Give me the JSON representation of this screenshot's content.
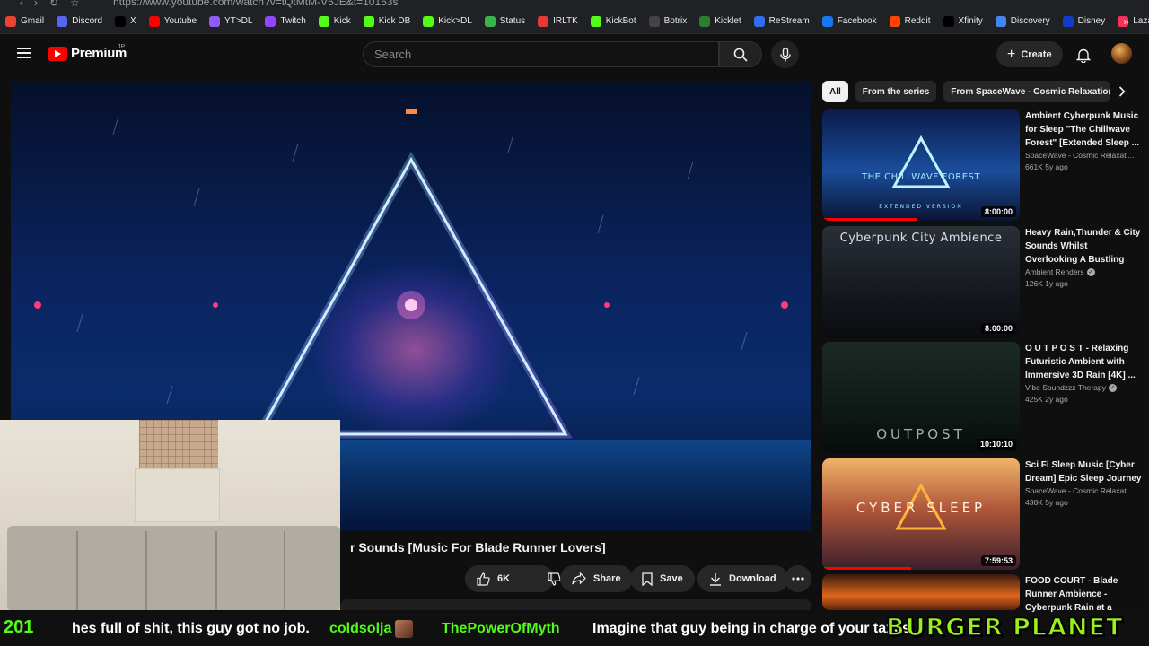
{
  "browser": {
    "url": "https://www.youtube.com/watch?v=tQtMtM-V5JE&t=10153s",
    "bookmarks": [
      {
        "label": "Gmail",
        "icon": "gmail-icon",
        "color": "#ea4335"
      },
      {
        "label": "Discord",
        "icon": "discord-icon",
        "color": "#5865f2"
      },
      {
        "label": "X",
        "icon": "x-icon",
        "color": "#000000"
      },
      {
        "label": "Youtube",
        "icon": "youtube-icon",
        "color": "#ff0000"
      },
      {
        "label": "YT>DL",
        "icon": "ytdl-icon",
        "color": "#8e5cf6"
      },
      {
        "label": "Twitch",
        "icon": "twitch-icon",
        "color": "#9146ff"
      },
      {
        "label": "Kick",
        "icon": "kick-icon",
        "color": "#53fc18"
      },
      {
        "label": "Kick DB",
        "icon": "kick-icon",
        "color": "#53fc18"
      },
      {
        "label": "Kick>DL",
        "icon": "kick-icon",
        "color": "#53fc18"
      },
      {
        "label": "Status",
        "icon": "status-icon",
        "color": "#3bb54a"
      },
      {
        "label": "IRLTK",
        "icon": "irltk-icon",
        "color": "#e53935"
      },
      {
        "label": "KickBot",
        "icon": "kickbot-icon",
        "color": "#53fc18"
      },
      {
        "label": "Botrix",
        "icon": "botrix-icon",
        "color": "#444444"
      },
      {
        "label": "Kicklet",
        "icon": "kicklet-icon",
        "color": "#2e7d32"
      },
      {
        "label": "ReStream",
        "icon": "restream-icon",
        "color": "#2f6fed"
      },
      {
        "label": "Facebook",
        "icon": "facebook-icon",
        "color": "#1877f2"
      },
      {
        "label": "Reddit",
        "icon": "reddit-icon",
        "color": "#ff4500"
      },
      {
        "label": "Xfinity",
        "icon": "xfinity-icon",
        "color": "#000000"
      },
      {
        "label": "Discovery",
        "icon": "discovery-icon",
        "color": "#4285f4"
      },
      {
        "label": "Disney",
        "icon": "disney-icon",
        "color": "#113ccf"
      },
      {
        "label": "Lazada",
        "icon": "lazada-icon",
        "color": "#f5315a"
      }
    ],
    "more_label": "»"
  },
  "header": {
    "brand": "Premium",
    "country": "JP",
    "search_placeholder": "Search",
    "create_label": "Create"
  },
  "video": {
    "title": "r Sounds [Music For Blade Runner Lovers]",
    "like_count": "6K",
    "share_label": "Share",
    "save_label": "Save",
    "download_label": "Download"
  },
  "sidebar": {
    "chips": [
      "All",
      "From the series",
      "From SpaceWave - Cosmic Relaxation"
    ],
    "recommendations": [
      {
        "title": "Ambient Cyberpunk Music for Sleep \"The Chillwave Forest\" [Extended Sleep ...",
        "channel": "SpaceWave - Cosmic Relaxati...",
        "stats": "661K  5y ago",
        "duration": "8:00:00",
        "thumb_text": "THE CHILLWAVE FOREST",
        "thumb_sub": "EXTENDED VERSION",
        "verified": false,
        "watched": 0.48
      },
      {
        "title": "Heavy Rain,Thunder & City Sounds Whilst Overlooking A Bustling NightTime ...",
        "channel": "Ambient Renders",
        "stats": "126K  1y ago",
        "duration": "8:00:00",
        "thumb_text": "Cyberpunk City Ambience",
        "thumb_sub": "",
        "verified": true,
        "watched": 0
      },
      {
        "title": "O U T P O S T  - Relaxing Futuristic Ambient with Immersive 3D Rain [4K] ...",
        "channel": "Vibe Soundzzz Therapy",
        "stats": "425K  2y ago",
        "duration": "10:10:10",
        "thumb_text": "OUTPOST",
        "thumb_sub": "",
        "verified": true,
        "watched": 0
      },
      {
        "title": "Sci Fi Sleep Music [Cyber Dream] Epic Sleep Journey",
        "channel": "SpaceWave - Cosmic Relaxati...",
        "stats": "438K  5y ago",
        "duration": "7:59:53",
        "thumb_text": "CYBER  SLEEP",
        "thumb_sub": "",
        "verified": false,
        "watched": 0.45
      },
      {
        "title": "FOOD COURT - Blade Runner Ambience - Cyberpunk Rain at a Nigh...",
        "channel": "",
        "stats": "",
        "duration": "",
        "thumb_text": "",
        "thumb_sub": "",
        "verified": false,
        "watched": 0
      }
    ]
  },
  "chat": {
    "count": "201",
    "message1": "hes full of shit, this guy got no job.",
    "user1": "coldsolja",
    "user2": "ThePowerOfMyth",
    "message2": "Imagine that guy being in charge of your taxes",
    "brand_overlay": "BURGER PLANET"
  },
  "colors": {
    "youtube_red": "#ff0000",
    "kick_green": "#53fc18",
    "burger_green": "#9bef1a",
    "page_bg": "#0f0f0f"
  }
}
